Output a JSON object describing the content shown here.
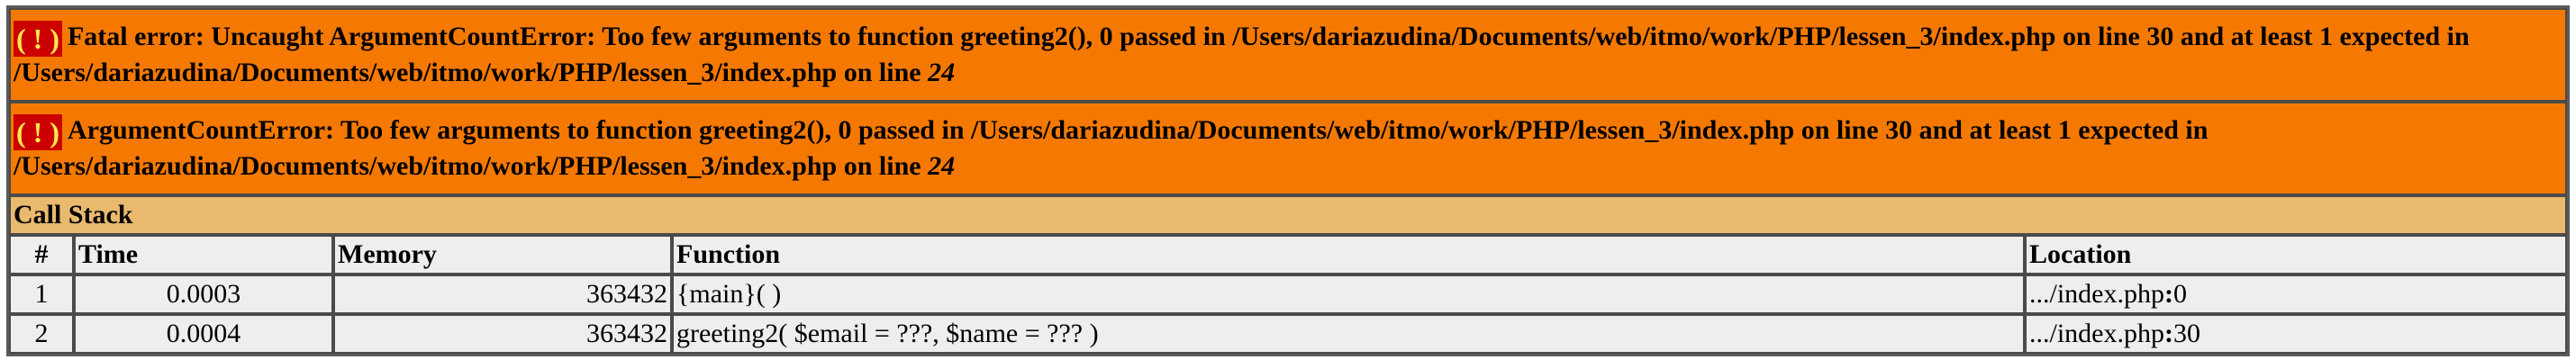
{
  "errors": [
    {
      "icon": "( ! )",
      "prefix": "Fatal error: Uncaught ArgumentCountError: Too few arguments to function greeting2(), 0 passed in /Users/dariazudina/Documents/web/itmo/work/PHP/lessen_3/index.php on line 30 and at least 1 expected in /Users/dariazudina/Documents/web/itmo/work/PHP/lessen_3/index.php on line ",
      "line": "24"
    },
    {
      "icon": "( ! )",
      "prefix": "ArgumentCountError: Too few arguments to function greeting2(), 0 passed in /Users/dariazudina/Documents/web/itmo/work/PHP/lessen_3/index.php on line 30 and at least 1 expected in /Users/dariazudina/Documents/web/itmo/work/PHP/lessen_3/index.php on line ",
      "line": "24"
    }
  ],
  "call_stack": {
    "title": "Call Stack",
    "headers": [
      "#",
      "Time",
      "Memory",
      "Function",
      "Location"
    ],
    "rows": [
      {
        "num": "1",
        "time": "0.0003",
        "memory": "363432",
        "function": "{main}( )",
        "location_file": ".../index.php",
        "location_sep": ":",
        "location_line": "0"
      },
      {
        "num": "2",
        "time": "0.0004",
        "memory": "363432",
        "function": "greeting2( $email = ???, $name = ??? )",
        "location_file": ".../index.php",
        "location_sep": ":",
        "location_line": "30"
      }
    ]
  },
  "colors": {
    "error_bg": "#f57900",
    "icon_bg": "#cc0000",
    "icon_fg": "#fce94f",
    "stack_bg": "#e9b96e",
    "cell_bg": "#eeeeec"
  }
}
